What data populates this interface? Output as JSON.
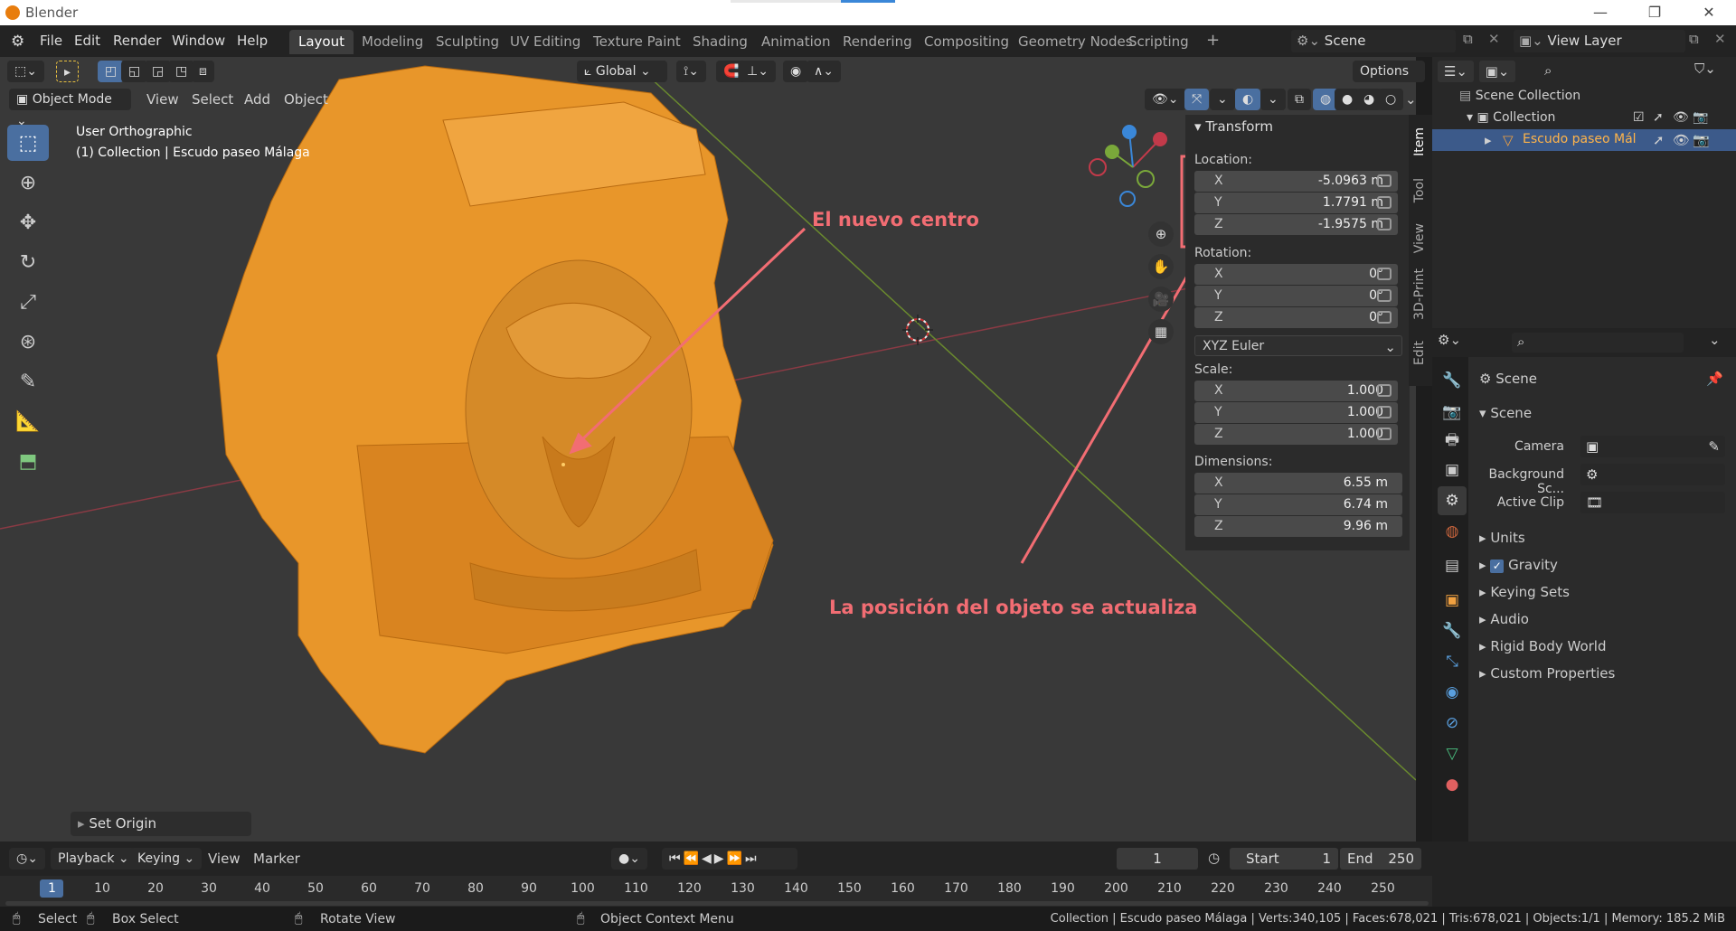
{
  "window": {
    "title": "Blender"
  },
  "menu": {
    "file": "File",
    "edit": "Edit",
    "render": "Render",
    "window": "Window",
    "help": "Help"
  },
  "workspaces": [
    "Layout",
    "Modeling",
    "Sculpting",
    "UV Editing",
    "Texture Paint",
    "Shading",
    "Animation",
    "Rendering",
    "Compositing",
    "Geometry Nodes",
    "Scripting"
  ],
  "scene": {
    "name": "Scene",
    "view_layer": "View Layer"
  },
  "viewport": {
    "mode": "Object Mode",
    "menus": [
      "View",
      "Select",
      "Add",
      "Object"
    ],
    "orientation": "Global",
    "options": "Options",
    "info_line1": "User Orthographic",
    "info_line2": "(1) Collection | Escudo paseo Málaga",
    "operator_panel": "Set Origin"
  },
  "annotations": {
    "center": "El nuevo centro",
    "position": "La posición del objeto se actualiza"
  },
  "npanel": {
    "tabs": [
      "Item",
      "Tool",
      "View",
      "3D-Print",
      "Edit"
    ],
    "section": "Transform",
    "location_label": "Location:",
    "location": [
      {
        "axis": "X",
        "value": "-5.0963 m"
      },
      {
        "axis": "Y",
        "value": "1.7791 m"
      },
      {
        "axis": "Z",
        "value": "-1.9575 m"
      }
    ],
    "rotation_label": "Rotation:",
    "rotation": [
      {
        "axis": "X",
        "value": "0°"
      },
      {
        "axis": "Y",
        "value": "0°"
      },
      {
        "axis": "Z",
        "value": "0°"
      }
    ],
    "rotation_mode": "XYZ Euler",
    "scale_label": "Scale:",
    "scale": [
      {
        "axis": "X",
        "value": "1.000"
      },
      {
        "axis": "Y",
        "value": "1.000"
      },
      {
        "axis": "Z",
        "value": "1.000"
      }
    ],
    "dimensions_label": "Dimensions:",
    "dimensions": [
      {
        "axis": "X",
        "value": "6.55 m"
      },
      {
        "axis": "Y",
        "value": "6.74 m"
      },
      {
        "axis": "Z",
        "value": "9.96 m"
      }
    ]
  },
  "outliner": {
    "scene_collection": "Scene Collection",
    "collection": "Collection",
    "object": "Escudo paseo Mál"
  },
  "properties": {
    "header": "Scene",
    "panel": "Scene",
    "camera_label": "Camera",
    "background_label": "Background Sc...",
    "active_clip_label": "Active Clip",
    "sections": [
      "Units",
      "Gravity",
      "Keying Sets",
      "Audio",
      "Rigid Body World",
      "Custom Properties"
    ]
  },
  "timeline": {
    "menus": [
      "Playback",
      "Keying",
      "View",
      "Marker"
    ],
    "current_frame": "1",
    "start_label": "Start",
    "start": "1",
    "end_label": "End",
    "end": "250",
    "ruler": [
      "1",
      "10",
      "20",
      "30",
      "40",
      "50",
      "60",
      "70",
      "80",
      "90",
      "100",
      "110",
      "120",
      "130",
      "140",
      "150",
      "160",
      "170",
      "180",
      "190",
      "200",
      "210",
      "220",
      "230",
      "240",
      "250"
    ]
  },
  "status": {
    "select": "Select",
    "box_select": "Box Select",
    "rotate_view": "Rotate View",
    "context_menu": "Object Context Menu",
    "info": "Collection | Escudo paseo Málaga | Verts:340,105 | Faces:678,021 | Tris:678,021 | Objects:1/1 | Memory: 185.2 MiB"
  },
  "colors": {
    "accent": "#4a6fa0",
    "object": "#e8962a",
    "annotation": "#f26d73",
    "x_axis": "#c23a4a",
    "y_axis": "#7aa83a"
  }
}
